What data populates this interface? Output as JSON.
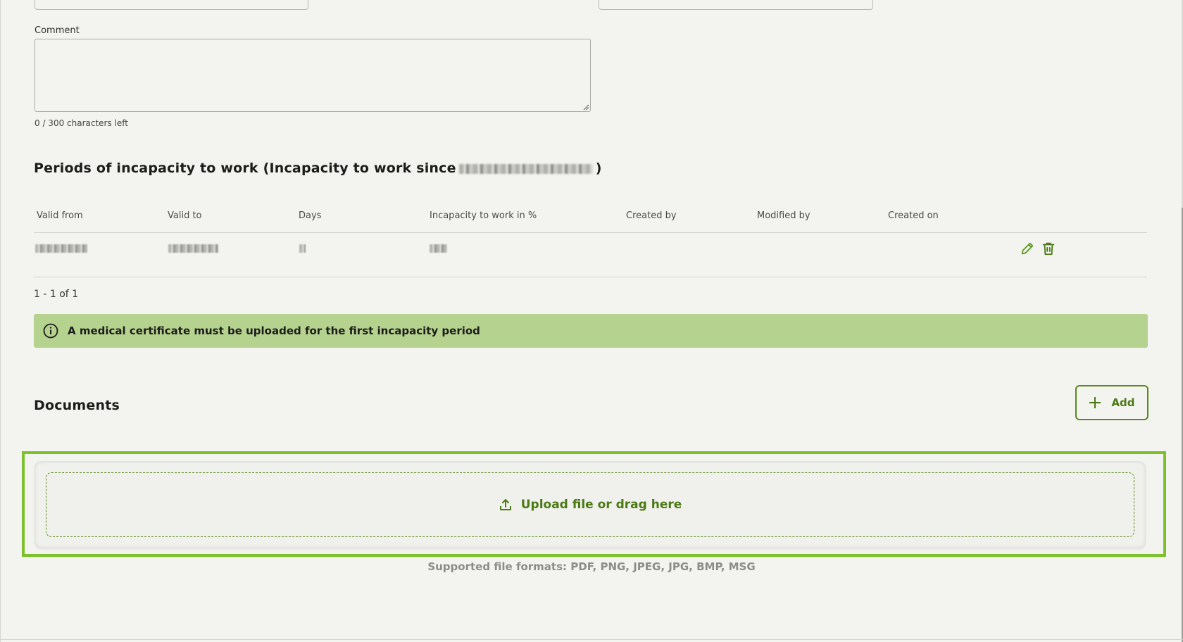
{
  "comment": {
    "label": "Comment",
    "value": "",
    "char_count": "0 / 300 characters left"
  },
  "periods": {
    "title_prefix": "Periods of incapacity to work (Incapacity to work since",
    "title_suffix": ")",
    "columns": [
      "Valid from",
      "Valid to",
      "Days",
      "Incapacity to work in %",
      "Created by",
      "Modified by",
      "Created on"
    ],
    "pagination": "1 - 1 of 1"
  },
  "banner": {
    "icon": "info-icon",
    "text": "A medical certificate must be uploaded for the first incapacity period",
    "color": "#b5d28e"
  },
  "documents": {
    "title": "Documents",
    "add_label": "Add",
    "upload_label": "Upload file or drag here",
    "formats": "Supported file formats: PDF, PNG, JPEG, JPG, BMP, MSG"
  },
  "colors": {
    "accent": "#4a7a14",
    "highlight_border": "#7cc02b",
    "background": "#f3f3ef"
  },
  "icons": {
    "edit": "pencil-icon",
    "delete": "trash-icon",
    "add": "plus-icon",
    "upload": "upload-icon"
  }
}
